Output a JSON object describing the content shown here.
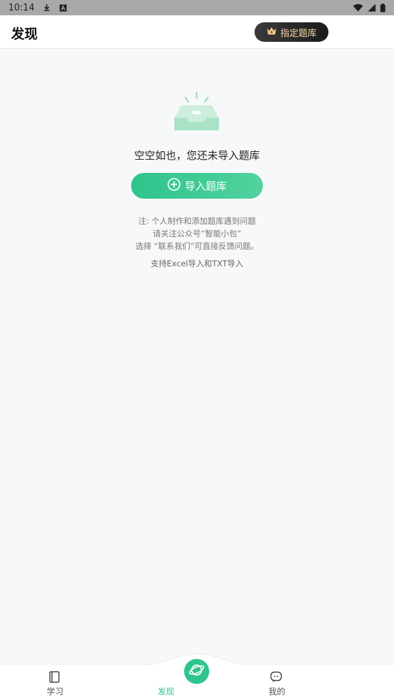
{
  "status_bar": {
    "time": "10:14",
    "icons": [
      "download-icon",
      "a-icon",
      "wifi-icon",
      "signal-icon",
      "battery-icon"
    ]
  },
  "header": {
    "title": "发现",
    "premium_button_label": "指定题库",
    "premium_icon": "crown-icon",
    "premium_text_color": "#f5d9a8"
  },
  "empty_state": {
    "message": "空空如也，您还未导入题库",
    "import_button_label": "导入题库",
    "import_icon": "plus-circle-icon",
    "notes": [
      "注: 个人制作和添加题库遇到问题",
      "请关注公众号“智能小包”",
      "选择 “联系我们”可直接反馈问题。"
    ],
    "support_text": "支持Excel导入和TXT导入"
  },
  "bottom_nav": {
    "items": [
      {
        "label": "学习",
        "icon": "book-icon",
        "active": false
      },
      {
        "label": "发现",
        "icon": "planet-icon",
        "active": true
      },
      {
        "label": "我的",
        "icon": "chat-face-icon",
        "active": false
      }
    ]
  },
  "colors": {
    "accent": "#2ec48b",
    "background": "#f7f8fa",
    "status_bar": "#a8a8a8"
  }
}
